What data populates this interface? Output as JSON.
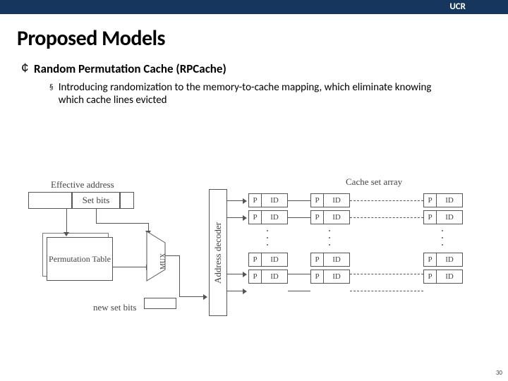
{
  "header": {
    "org": "UCR"
  },
  "slide": {
    "title": "Proposed Models",
    "pagenum": "30"
  },
  "bullets": {
    "b1": {
      "text": "Random Permutation Cache (RPCache)"
    },
    "b1_1": {
      "text": "Introducing randomization to the memory-to-cache mapping, which eliminate knowing which cache lines evicted"
    }
  },
  "diagram": {
    "eff_addr": "Effective address",
    "cache_set_array": "Cache set array",
    "set_bits": "Set bits",
    "perm_table": "Permutation Table",
    "mux": "MUX",
    "new_set_bits": "new set bits",
    "addr_dec": "Address decoder",
    "p": "P",
    "id": "ID"
  }
}
